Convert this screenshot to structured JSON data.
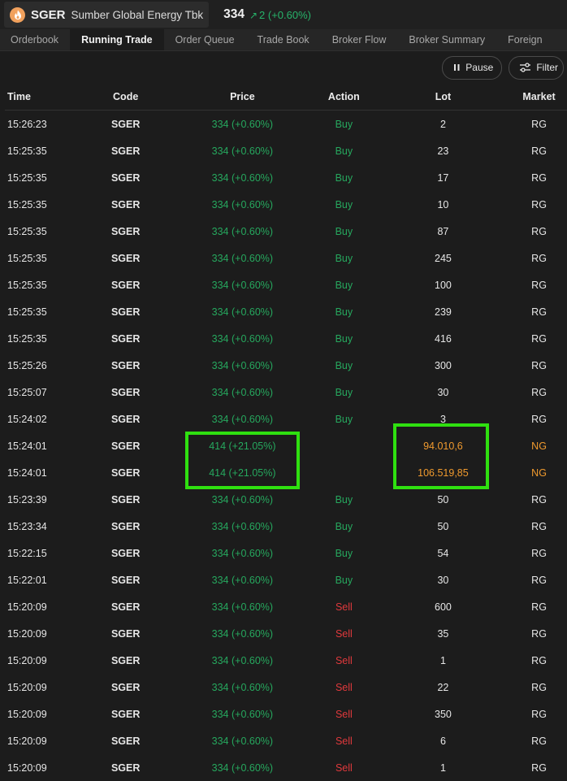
{
  "header": {
    "ticker": "SGER",
    "company": "Sumber Global Energy Tbk",
    "last_price": "334",
    "change_arrow": "↗",
    "change": "2 (+0.60%)",
    "logo_icon": "flame-icon"
  },
  "tabs": [
    {
      "label": "Orderbook",
      "active": false
    },
    {
      "label": "Running Trade",
      "active": true
    },
    {
      "label": "Order Queue",
      "active": false
    },
    {
      "label": "Trade Book",
      "active": false
    },
    {
      "label": "Broker Flow",
      "active": false
    },
    {
      "label": "Broker Summary",
      "active": false
    },
    {
      "label": "Foreign",
      "active": false
    }
  ],
  "toolbar": {
    "pause_label": "Pause",
    "pause_icon": "pause-icon",
    "filter_label": "Filter",
    "filter_icon": "sliders-icon"
  },
  "columns": {
    "time": "Time",
    "code": "Code",
    "price": "Price",
    "action": "Action",
    "lot": "Lot",
    "market": "Market"
  },
  "colors": {
    "up": "#26a85e",
    "down": "#e0393c",
    "negotiated": "#f09a2e",
    "highlight": "#2fe010"
  },
  "rows": [
    {
      "time": "15:26:23",
      "code": "SGER",
      "price": "334 (+0.60%)",
      "action": "Buy",
      "lot": "2",
      "market": "RG"
    },
    {
      "time": "15:25:35",
      "code": "SGER",
      "price": "334 (+0.60%)",
      "action": "Buy",
      "lot": "23",
      "market": "RG"
    },
    {
      "time": "15:25:35",
      "code": "SGER",
      "price": "334 (+0.60%)",
      "action": "Buy",
      "lot": "17",
      "market": "RG"
    },
    {
      "time": "15:25:35",
      "code": "SGER",
      "price": "334 (+0.60%)",
      "action": "Buy",
      "lot": "10",
      "market": "RG"
    },
    {
      "time": "15:25:35",
      "code": "SGER",
      "price": "334 (+0.60%)",
      "action": "Buy",
      "lot": "87",
      "market": "RG"
    },
    {
      "time": "15:25:35",
      "code": "SGER",
      "price": "334 (+0.60%)",
      "action": "Buy",
      "lot": "245",
      "market": "RG"
    },
    {
      "time": "15:25:35",
      "code": "SGER",
      "price": "334 (+0.60%)",
      "action": "Buy",
      "lot": "100",
      "market": "RG"
    },
    {
      "time": "15:25:35",
      "code": "SGER",
      "price": "334 (+0.60%)",
      "action": "Buy",
      "lot": "239",
      "market": "RG"
    },
    {
      "time": "15:25:35",
      "code": "SGER",
      "price": "334 (+0.60%)",
      "action": "Buy",
      "lot": "416",
      "market": "RG"
    },
    {
      "time": "15:25:26",
      "code": "SGER",
      "price": "334 (+0.60%)",
      "action": "Buy",
      "lot": "300",
      "market": "RG"
    },
    {
      "time": "15:25:07",
      "code": "SGER",
      "price": "334 (+0.60%)",
      "action": "Buy",
      "lot": "30",
      "market": "RG"
    },
    {
      "time": "15:24:02",
      "code": "SGER",
      "price": "334 (+0.60%)",
      "action": "Buy",
      "lot": "3",
      "market": "RG"
    },
    {
      "time": "15:24:01",
      "code": "SGER",
      "price": "414 (+21.05%)",
      "action": "",
      "lot": "94.010,6",
      "market": "NG"
    },
    {
      "time": "15:24:01",
      "code": "SGER",
      "price": "414 (+21.05%)",
      "action": "",
      "lot": "106.519,85",
      "market": "NG"
    },
    {
      "time": "15:23:39",
      "code": "SGER",
      "price": "334 (+0.60%)",
      "action": "Buy",
      "lot": "50",
      "market": "RG"
    },
    {
      "time": "15:23:34",
      "code": "SGER",
      "price": "334 (+0.60%)",
      "action": "Buy",
      "lot": "50",
      "market": "RG"
    },
    {
      "time": "15:22:15",
      "code": "SGER",
      "price": "334 (+0.60%)",
      "action": "Buy",
      "lot": "54",
      "market": "RG"
    },
    {
      "time": "15:22:01",
      "code": "SGER",
      "price": "334 (+0.60%)",
      "action": "Buy",
      "lot": "30",
      "market": "RG"
    },
    {
      "time": "15:20:09",
      "code": "SGER",
      "price": "334 (+0.60%)",
      "action": "Sell",
      "lot": "600",
      "market": "RG"
    },
    {
      "time": "15:20:09",
      "code": "SGER",
      "price": "334 (+0.60%)",
      "action": "Sell",
      "lot": "35",
      "market": "RG"
    },
    {
      "time": "15:20:09",
      "code": "SGER",
      "price": "334 (+0.60%)",
      "action": "Sell",
      "lot": "1",
      "market": "RG"
    },
    {
      "time": "15:20:09",
      "code": "SGER",
      "price": "334 (+0.60%)",
      "action": "Sell",
      "lot": "22",
      "market": "RG"
    },
    {
      "time": "15:20:09",
      "code": "SGER",
      "price": "334 (+0.60%)",
      "action": "Sell",
      "lot": "350",
      "market": "RG"
    },
    {
      "time": "15:20:09",
      "code": "SGER",
      "price": "334 (+0.60%)",
      "action": "Sell",
      "lot": "6",
      "market": "RG"
    },
    {
      "time": "15:20:09",
      "code": "SGER",
      "price": "334 (+0.60%)",
      "action": "Sell",
      "lot": "1",
      "market": "RG"
    }
  ]
}
